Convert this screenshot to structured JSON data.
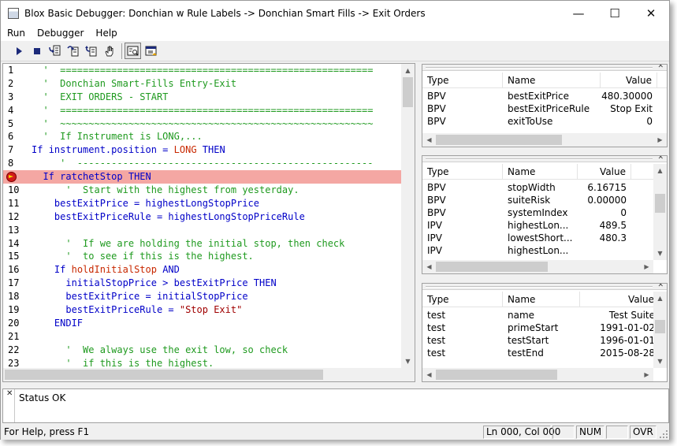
{
  "window": {
    "title": "Blox Basic Debugger: Donchian w Rule Labels -> Donchian Smart Fills -> Exit Orders",
    "controls": {
      "minimize": "—",
      "maximize": "☐",
      "close": "✕"
    }
  },
  "menu": [
    "Run",
    "Debugger",
    "Help"
  ],
  "toolbar": {
    "buttons": [
      "run-icon",
      "stop-icon",
      "step-into-icon",
      "step-over-icon",
      "step-out-icon",
      "hand-icon",
      "watch-icon",
      "watch-window-icon"
    ]
  },
  "editor": {
    "current_line": 9,
    "lines": [
      {
        "no": "1",
        "indent": "  ",
        "parts": [
          {
            "t": "'  =======================================================",
            "c": "comment"
          }
        ]
      },
      {
        "no": "2",
        "indent": "  ",
        "parts": [
          {
            "t": "'  Donchian Smart-Fills Entry-Exit",
            "c": "comment"
          }
        ]
      },
      {
        "no": "3",
        "indent": "  ",
        "parts": [
          {
            "t": "'  EXIT ORDERS - START",
            "c": "comment"
          }
        ]
      },
      {
        "no": "4",
        "indent": "  ",
        "parts": [
          {
            "t": "'  =======================================================",
            "c": "comment"
          }
        ]
      },
      {
        "no": "5",
        "indent": "  ",
        "parts": [
          {
            "t": "'  ~~~~~~~~~~~~~~~~~~~~~~~~~~~~~~~~~~~~~~~~~~~~~~~~~~~~~~~",
            "c": "comment"
          }
        ]
      },
      {
        "no": "6",
        "indent": "  ",
        "parts": [
          {
            "t": "'  If Instrument is LONG,...",
            "c": "comment"
          }
        ]
      },
      {
        "no": "7",
        "indent": "",
        "parts": [
          {
            "t": "If ",
            "c": "keyword"
          },
          {
            "t": "instrument.position = ",
            "c": "plain"
          },
          {
            "t": "LONG",
            "c": "red"
          },
          {
            "t": " THEN",
            "c": "keyword"
          }
        ]
      },
      {
        "no": "8",
        "indent": "     ",
        "parts": [
          {
            "t": "'  ----------------------------------------------------",
            "c": "comment"
          }
        ]
      },
      {
        "no": "9",
        "indent": "  ",
        "parts": [
          {
            "t": "If ",
            "c": "keyword"
          },
          {
            "t": "ratchetStop",
            "c": "plain"
          },
          {
            "t": " THEN",
            "c": "keyword"
          }
        ]
      },
      {
        "no": "10",
        "indent": "      ",
        "parts": [
          {
            "t": "'  Start with the highest from yesterday.",
            "c": "comment"
          }
        ]
      },
      {
        "no": "11",
        "indent": "    ",
        "parts": [
          {
            "t": "bestExitPrice = highestLongStopPrice",
            "c": "plain"
          }
        ]
      },
      {
        "no": "12",
        "indent": "    ",
        "parts": [
          {
            "t": "bestExitPriceRule = highestLongStopPriceRule",
            "c": "plain"
          }
        ]
      },
      {
        "no": "13",
        "indent": "",
        "parts": []
      },
      {
        "no": "14",
        "indent": "      ",
        "parts": [
          {
            "t": "'  If we are holding the initial stop, then check",
            "c": "comment"
          }
        ]
      },
      {
        "no": "15",
        "indent": "      ",
        "parts": [
          {
            "t": "'  to see if this is the highest.",
            "c": "comment"
          }
        ]
      },
      {
        "no": "16",
        "indent": "    ",
        "parts": [
          {
            "t": "If ",
            "c": "keyword"
          },
          {
            "t": "holdInitialStop",
            "c": "red"
          },
          {
            "t": " AND",
            "c": "keyword"
          }
        ]
      },
      {
        "no": "17",
        "indent": "      ",
        "parts": [
          {
            "t": "initialStopPrice > bestExitPrice ",
            "c": "plain"
          },
          {
            "t": "THEN",
            "c": "keyword"
          }
        ]
      },
      {
        "no": "18",
        "indent": "      ",
        "parts": [
          {
            "t": "bestExitPrice = initialStopPrice",
            "c": "plain"
          }
        ]
      },
      {
        "no": "19",
        "indent": "      ",
        "parts": [
          {
            "t": "bestExitPriceRule = ",
            "c": "plain"
          },
          {
            "t": "\"Stop Exit\"",
            "c": "string"
          }
        ]
      },
      {
        "no": "20",
        "indent": "    ",
        "parts": [
          {
            "t": "ENDIF",
            "c": "keyword"
          }
        ]
      },
      {
        "no": "21",
        "indent": "",
        "parts": []
      },
      {
        "no": "22",
        "indent": "      ",
        "parts": [
          {
            "t": "'  We always use the exit low, so check",
            "c": "comment"
          }
        ]
      },
      {
        "no": "23",
        "indent": "      ",
        "parts": [
          {
            "t": "'  if this is the highest.",
            "c": "comment"
          }
        ]
      }
    ]
  },
  "panes": [
    {
      "columns": [
        "Type",
        "Name",
        "Value"
      ],
      "rows": [
        [
          "BPV",
          "bestExitPrice",
          "480.30000"
        ],
        [
          "BPV",
          "bestExitPriceRule",
          "Stop Exit"
        ],
        [
          "BPV",
          "exitToUse",
          "0"
        ]
      ]
    },
    {
      "columns": [
        "Type",
        "Name",
        "Value"
      ],
      "rows": [
        [
          "BPV",
          "stopWidth",
          "6.16715"
        ],
        [
          "BPV",
          "suiteRisk",
          "0.00000"
        ],
        [
          "BPV",
          "systemIndex",
          "0"
        ],
        [
          "IPV",
          "highestLon...",
          "489.5"
        ],
        [
          "IPV",
          "lowestShort...",
          "480.3"
        ],
        [
          "IPV",
          "highestLon...",
          ""
        ]
      ]
    },
    {
      "columns": [
        "Type",
        "Name",
        "Value"
      ],
      "rows": [
        [
          "test",
          "name",
          "Test Suite"
        ],
        [
          "test",
          "primeStart",
          "1991-01-02"
        ],
        [
          "test",
          "testStart",
          "1996-01-01"
        ],
        [
          "test",
          "testEnd",
          "2015-08-28"
        ]
      ]
    }
  ],
  "status": {
    "message": "Status OK",
    "help": "For Help, press F1",
    "position": "Ln 000, Col 000",
    "num": "NUM",
    "ovr": "OVR"
  }
}
